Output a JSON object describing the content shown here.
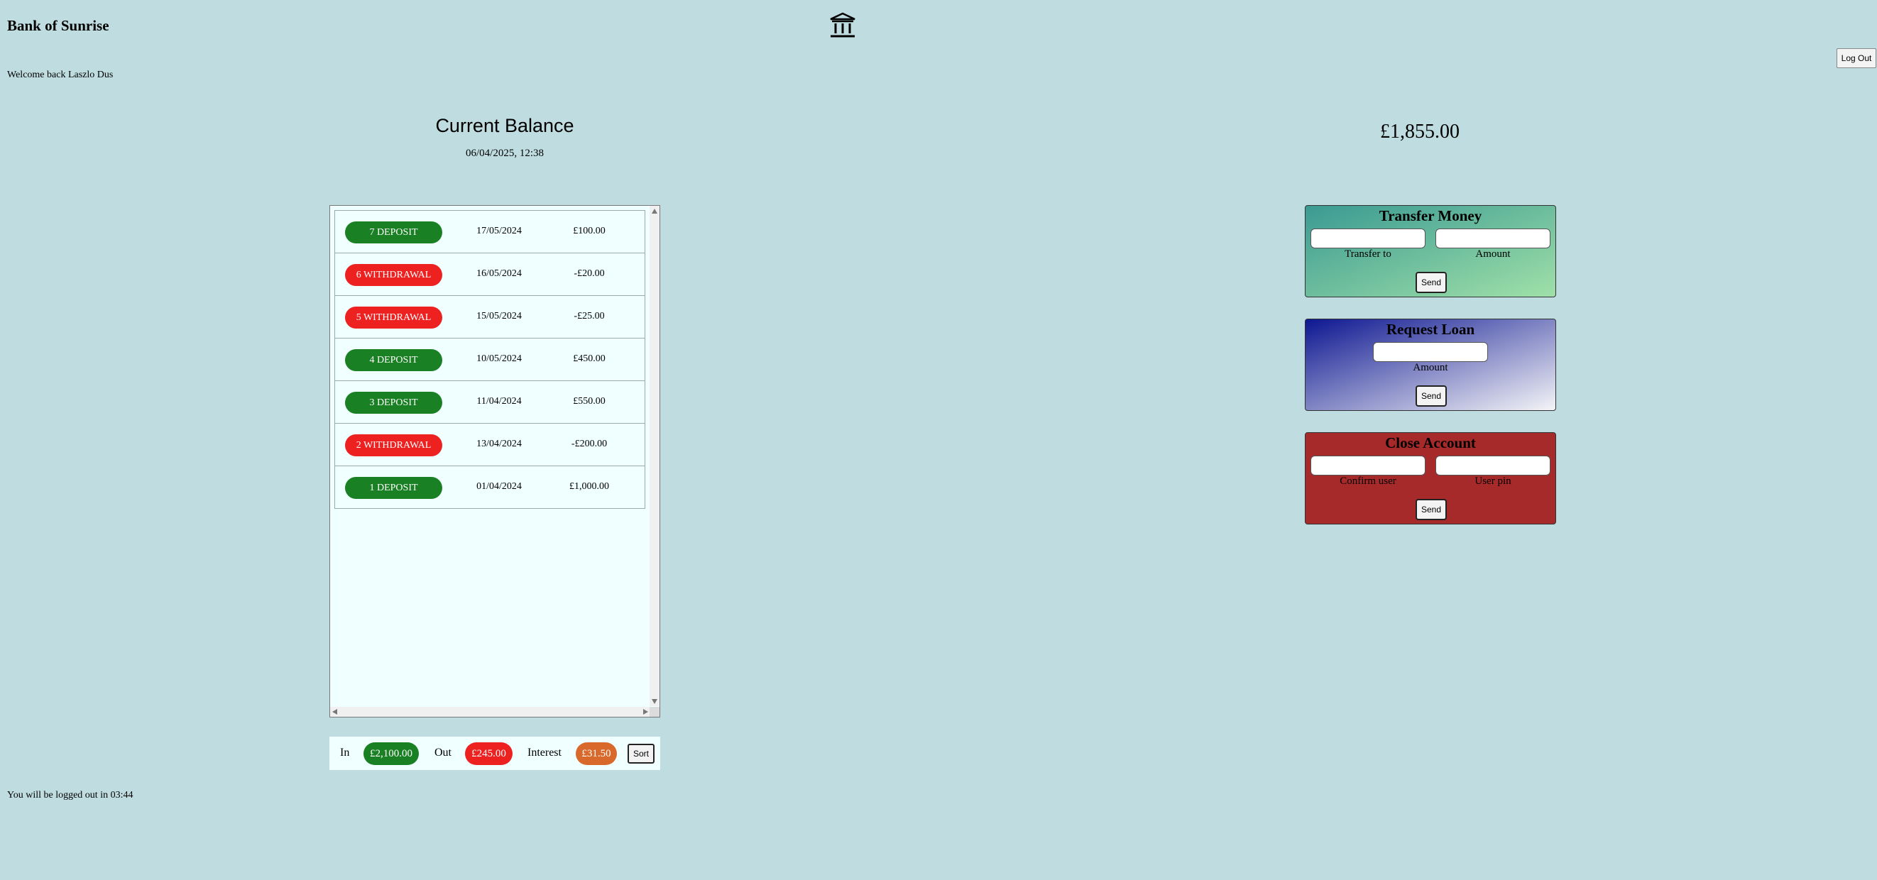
{
  "header": {
    "app_title": "Bank of Sunrise",
    "welcome": "Welcome back Laszlo Dus",
    "logout_label": "Log Out",
    "logo_icon": "bank-building-icon"
  },
  "balance": {
    "title": "Current Balance",
    "date": "06/04/2025, 12:38",
    "amount": "£1,855.00"
  },
  "movements": [
    {
      "label": "7 DEPOSIT",
      "type": "deposit",
      "date": "17/05/2024",
      "value": "£100.00"
    },
    {
      "label": "6 WITHDRAWAL",
      "type": "withdrawal",
      "date": "16/05/2024",
      "value": "-£20.00"
    },
    {
      "label": "5 WITHDRAWAL",
      "type": "withdrawal",
      "date": "15/05/2024",
      "value": "-£25.00"
    },
    {
      "label": "4 DEPOSIT",
      "type": "deposit",
      "date": "10/05/2024",
      "value": "£450.00"
    },
    {
      "label": "3 DEPOSIT",
      "type": "deposit",
      "date": "11/04/2024",
      "value": "£550.00"
    },
    {
      "label": "2 WITHDRAWAL",
      "type": "withdrawal",
      "date": "13/04/2024",
      "value": "-£200.00"
    },
    {
      "label": "1 DEPOSIT",
      "type": "deposit",
      "date": "01/04/2024",
      "value": "£1,000.00"
    }
  ],
  "summary": {
    "in_label": "In",
    "in_value": "£2,100.00",
    "out_label": "Out",
    "out_value": "£245.00",
    "interest_label": "Interest",
    "interest_value": "£31.50",
    "sort_label": "Sort"
  },
  "operations": {
    "transfer": {
      "title": "Transfer Money",
      "field1_label": "Transfer to",
      "field2_label": "Amount",
      "send_label": "Send"
    },
    "loan": {
      "title": "Request Loan",
      "field_label": "Amount",
      "send_label": "Send"
    },
    "close": {
      "title": "Close Account",
      "field1_label": "Confirm user",
      "field2_label": "User pin",
      "send_label": "Send"
    }
  },
  "timer_text": "You will be logged out in 03:44",
  "colors": {
    "background": "#bfdde0",
    "deposit": "#1a8024",
    "withdrawal": "#ee2121",
    "interest": "#d9692a",
    "close_account": "#a62a2a"
  }
}
